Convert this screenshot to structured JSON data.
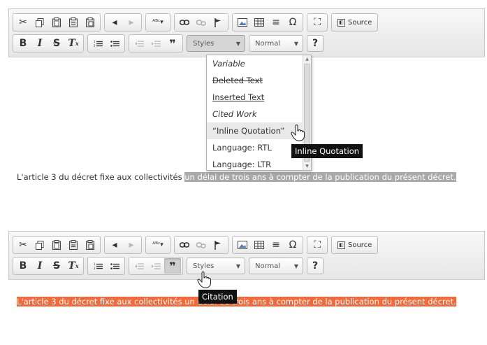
{
  "toolbar": {
    "source_label": "Source",
    "styles_label": "Styles",
    "format_label": "Normal",
    "help_label": "?"
  },
  "styles_menu": {
    "items": [
      {
        "label": "Variable"
      },
      {
        "label": "Deleted Text"
      },
      {
        "label": "Inserted Text"
      },
      {
        "label": "Cited Work"
      },
      {
        "label": "“Inline Quotation”"
      },
      {
        "label": "Language: RTL"
      },
      {
        "label": "Language: LTR"
      }
    ]
  },
  "tooltips": {
    "top": "Inline Quotation",
    "bottom": "Citation"
  },
  "content": {
    "top_before": "L'article 3 du décret fixe aux collectivités ",
    "top_selected": "un délai de trois ans à compter de la publication du présent décret.",
    "bottom_selected": "L'article 3 du décret fixe aux collectivités un délai de trois ans à compter de la publication du présent décret."
  },
  "colors": {
    "selection_gray": "#a9a9a9",
    "selection_orange": "#f06a3c",
    "tooltip_bg": "#111111"
  }
}
